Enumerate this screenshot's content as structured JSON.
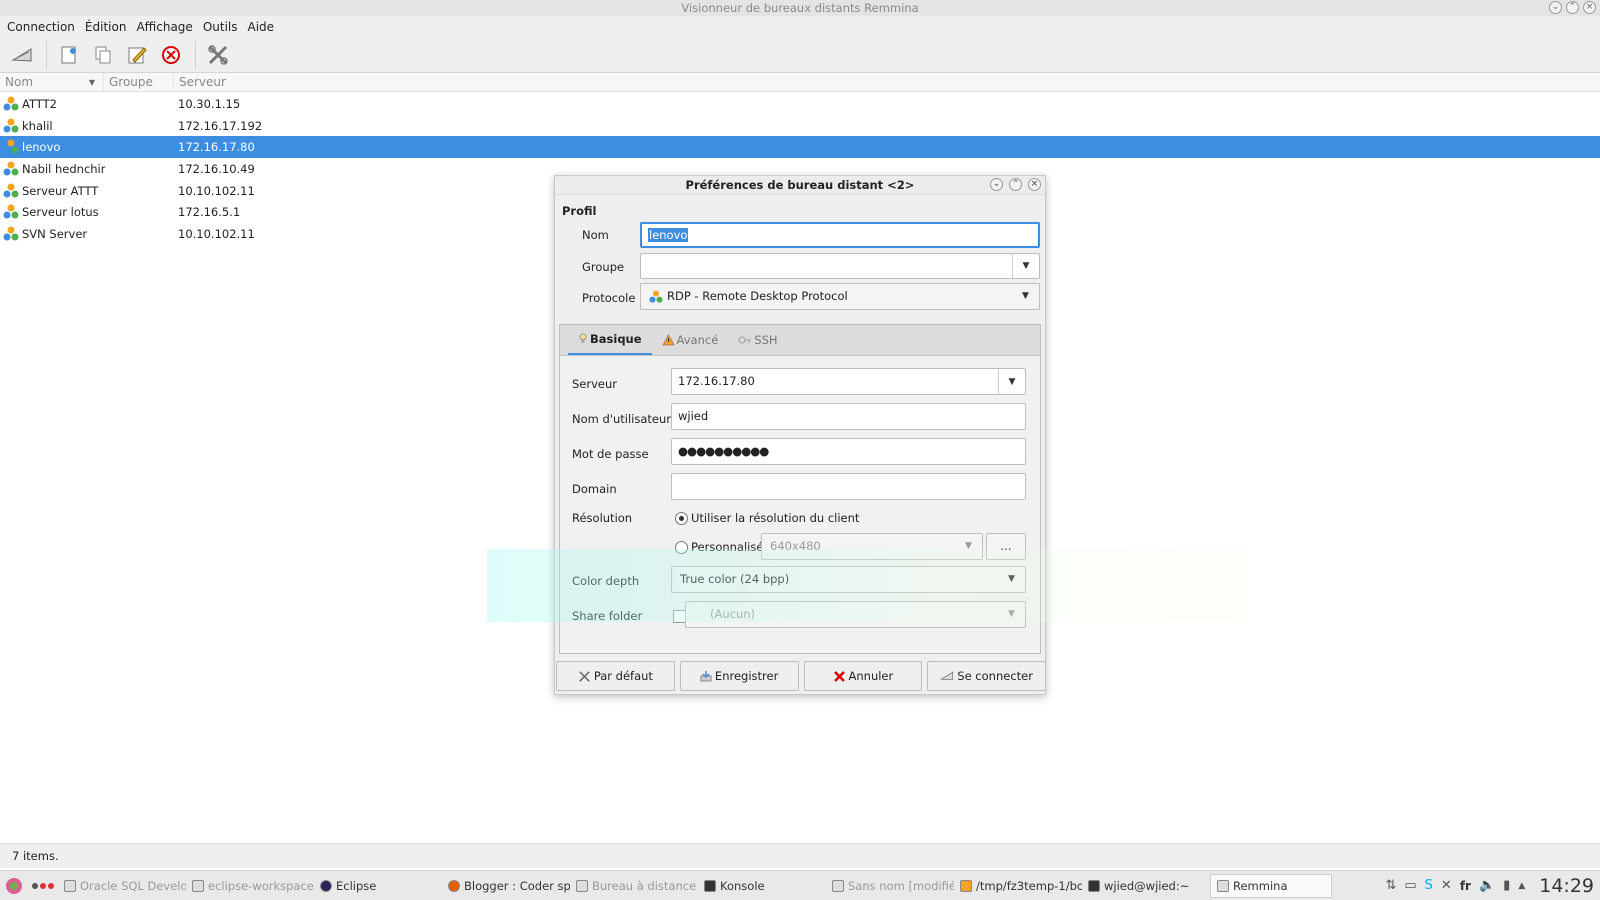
{
  "window": {
    "title": "Visionneur de bureaux distants Remmina"
  },
  "menu": [
    "Connection",
    "Édition",
    "Affichage",
    "Outils",
    "Aide"
  ],
  "list": {
    "headers": {
      "nom": "Nom",
      "groupe": "Groupe",
      "serveur": "Serveur"
    },
    "rows": [
      {
        "name": "ATTT2",
        "server": "10.30.1.15"
      },
      {
        "name": "khalil",
        "server": "172.16.17.192"
      },
      {
        "name": "lenovo",
        "server": "172.16.17.80"
      },
      {
        "name": "Nabil hednchir",
        "server": "172.16.10.49"
      },
      {
        "name": "Serveur ATTT",
        "server": "10.10.102.11"
      },
      {
        "name": "Serveur lotus",
        "server": "172.16.5.1"
      },
      {
        "name": "SVN Server",
        "server": "10.10.102.11"
      }
    ],
    "selected_index": 2
  },
  "status": {
    "text": "7 items."
  },
  "dialog": {
    "title": "Préférences de bureau distant <2>",
    "section": "Profil",
    "nom_label": "Nom",
    "nom_value": "lenovo",
    "groupe_label": "Groupe",
    "groupe_value": "",
    "protocole_label": "Protocole",
    "protocole_value": "RDP - Remote Desktop Protocol",
    "tabs": [
      "Basique",
      "Avancé",
      "SSH"
    ],
    "serveur_label": "Serveur",
    "serveur_value": "172.16.17.80",
    "user_label": "Nom d'utilisateur",
    "user_value": "wjied",
    "password_label": "Mot de passe",
    "password_value": "●●●●●●●●●●",
    "domain_label": "Domain",
    "domain_value": "",
    "resolution_label": "Résolution",
    "res_client_label": "Utiliser la résolution du client",
    "res_custom_label": "Personnalisé",
    "res_custom_value": "640x480",
    "res_more": "...",
    "color_label": "Color depth",
    "color_value": "True color (24 bpp)",
    "share_label": "Share folder",
    "share_value": "(Aucun)",
    "buttons": {
      "default": "Par défaut",
      "save": "Enregistrer",
      "cancel": "Annuler",
      "connect": "Se connecter"
    }
  },
  "taskbar": {
    "tasks": [
      {
        "label": "Oracle SQL Develo",
        "state": "dim"
      },
      {
        "label": "eclipse-workspace",
        "state": "dim"
      },
      {
        "label": "Eclipse",
        "state": "normal"
      },
      {
        "label": "Blogger : Coder spi",
        "state": "normal"
      },
      {
        "label": "Bureau à distance",
        "state": "dim"
      },
      {
        "label": "Konsole",
        "state": "normal"
      },
      {
        "label": "Sans nom [modifié]",
        "state": "dim"
      },
      {
        "label": "/tmp/fz3temp-1/bo",
        "state": "normal"
      },
      {
        "label": "wjied@wjied:~",
        "state": "normal"
      },
      {
        "label": "Remmina",
        "state": "active"
      }
    ],
    "layout": "fr",
    "clock": "14:29"
  }
}
